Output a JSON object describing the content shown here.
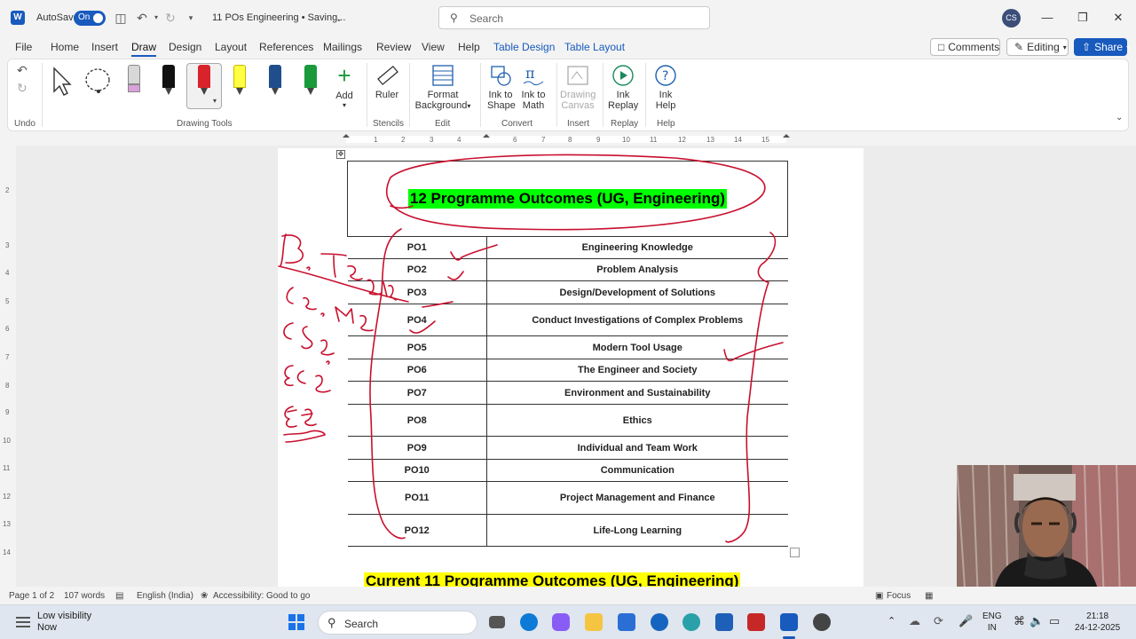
{
  "titlebar": {
    "autosave_label": "AutoSave",
    "autosave_state": "On",
    "doc_title": "11 POs Engineering • Saving...",
    "search_placeholder": "Search",
    "user_initials": "CS"
  },
  "tabs": [
    "File",
    "Home",
    "Insert",
    "Draw",
    "Design",
    "Layout",
    "References",
    "Mailings",
    "Review",
    "View",
    "Help",
    "Table Design",
    "Table Layout"
  ],
  "active_tab": "Draw",
  "right_buttons": {
    "comments": "Comments",
    "editing": "Editing",
    "share": "Share"
  },
  "ribbon": {
    "undo_label": "Undo",
    "drawing_tools_label": "Drawing Tools",
    "add_label": "Add",
    "ruler_label": "Ruler",
    "stencils_label": "Stencils",
    "format_bg_label_1": "Format",
    "format_bg_label_2": "Background",
    "edit_label": "Edit",
    "ink_shape_1": "Ink to",
    "ink_shape_2": "Shape",
    "ink_math_1": "Ink to",
    "ink_math_2": "Math",
    "convert_label": "Convert",
    "drawing_canvas_1": "Drawing",
    "drawing_canvas_2": "Canvas",
    "insert_label": "Insert",
    "ink_replay_1": "Ink",
    "ink_replay_2": "Replay",
    "replay_label": "Replay",
    "ink_help_1": "Ink",
    "ink_help_2": "Help",
    "help_label": "Help",
    "pen_colors": [
      "#111111",
      "#d8232a",
      "#ffff44",
      "#1f4e8c",
      "#1a9a3a"
    ]
  },
  "document": {
    "table_heading": "12  Programme Outcomes (UG, Engineering)",
    "rows": [
      {
        "code": "PO1",
        "name": "Engineering Knowledge"
      },
      {
        "code": "PO2",
        "name": "Problem Analysis"
      },
      {
        "code": "PO3",
        "name": "Design/Development of Solutions"
      },
      {
        "code": "PO4",
        "name": "Conduct Investigations of Complex Problems"
      },
      {
        "code": "PO5",
        "name": "Modern Tool Usage"
      },
      {
        "code": "PO6",
        "name": "The Engineer and Society"
      },
      {
        "code": "PO7",
        "name": "Environment and Sustainability"
      },
      {
        "code": "PO8",
        "name": "Ethics"
      },
      {
        "code": "PO9",
        "name": "Individual and Team Work"
      },
      {
        "code": "PO10",
        "name": "Communication"
      },
      {
        "code": "PO11",
        "name": "Project Management and Finance"
      },
      {
        "code": "PO12",
        "name": "Life-Long Learning"
      }
    ],
    "next_heading": "Current 11 Programme Outcomes (UG, Engineering)"
  },
  "statusbar": {
    "page": "Page 1 of 2",
    "words": "107 words",
    "language": "English (India)",
    "accessibility": "Accessibility: Good to go",
    "focus": "Focus"
  },
  "taskbar": {
    "weather_title": "Low visibility",
    "weather_sub": "Now",
    "search": "Search",
    "lang_1": "ENG",
    "lang_2": "IN",
    "time": "21:18",
    "date": "24-12-2025"
  },
  "colors": {
    "accent": "#185abd",
    "ink": "#c8102e",
    "highlight_green": "#00ff00",
    "highlight_yellow": "#ffff00"
  }
}
